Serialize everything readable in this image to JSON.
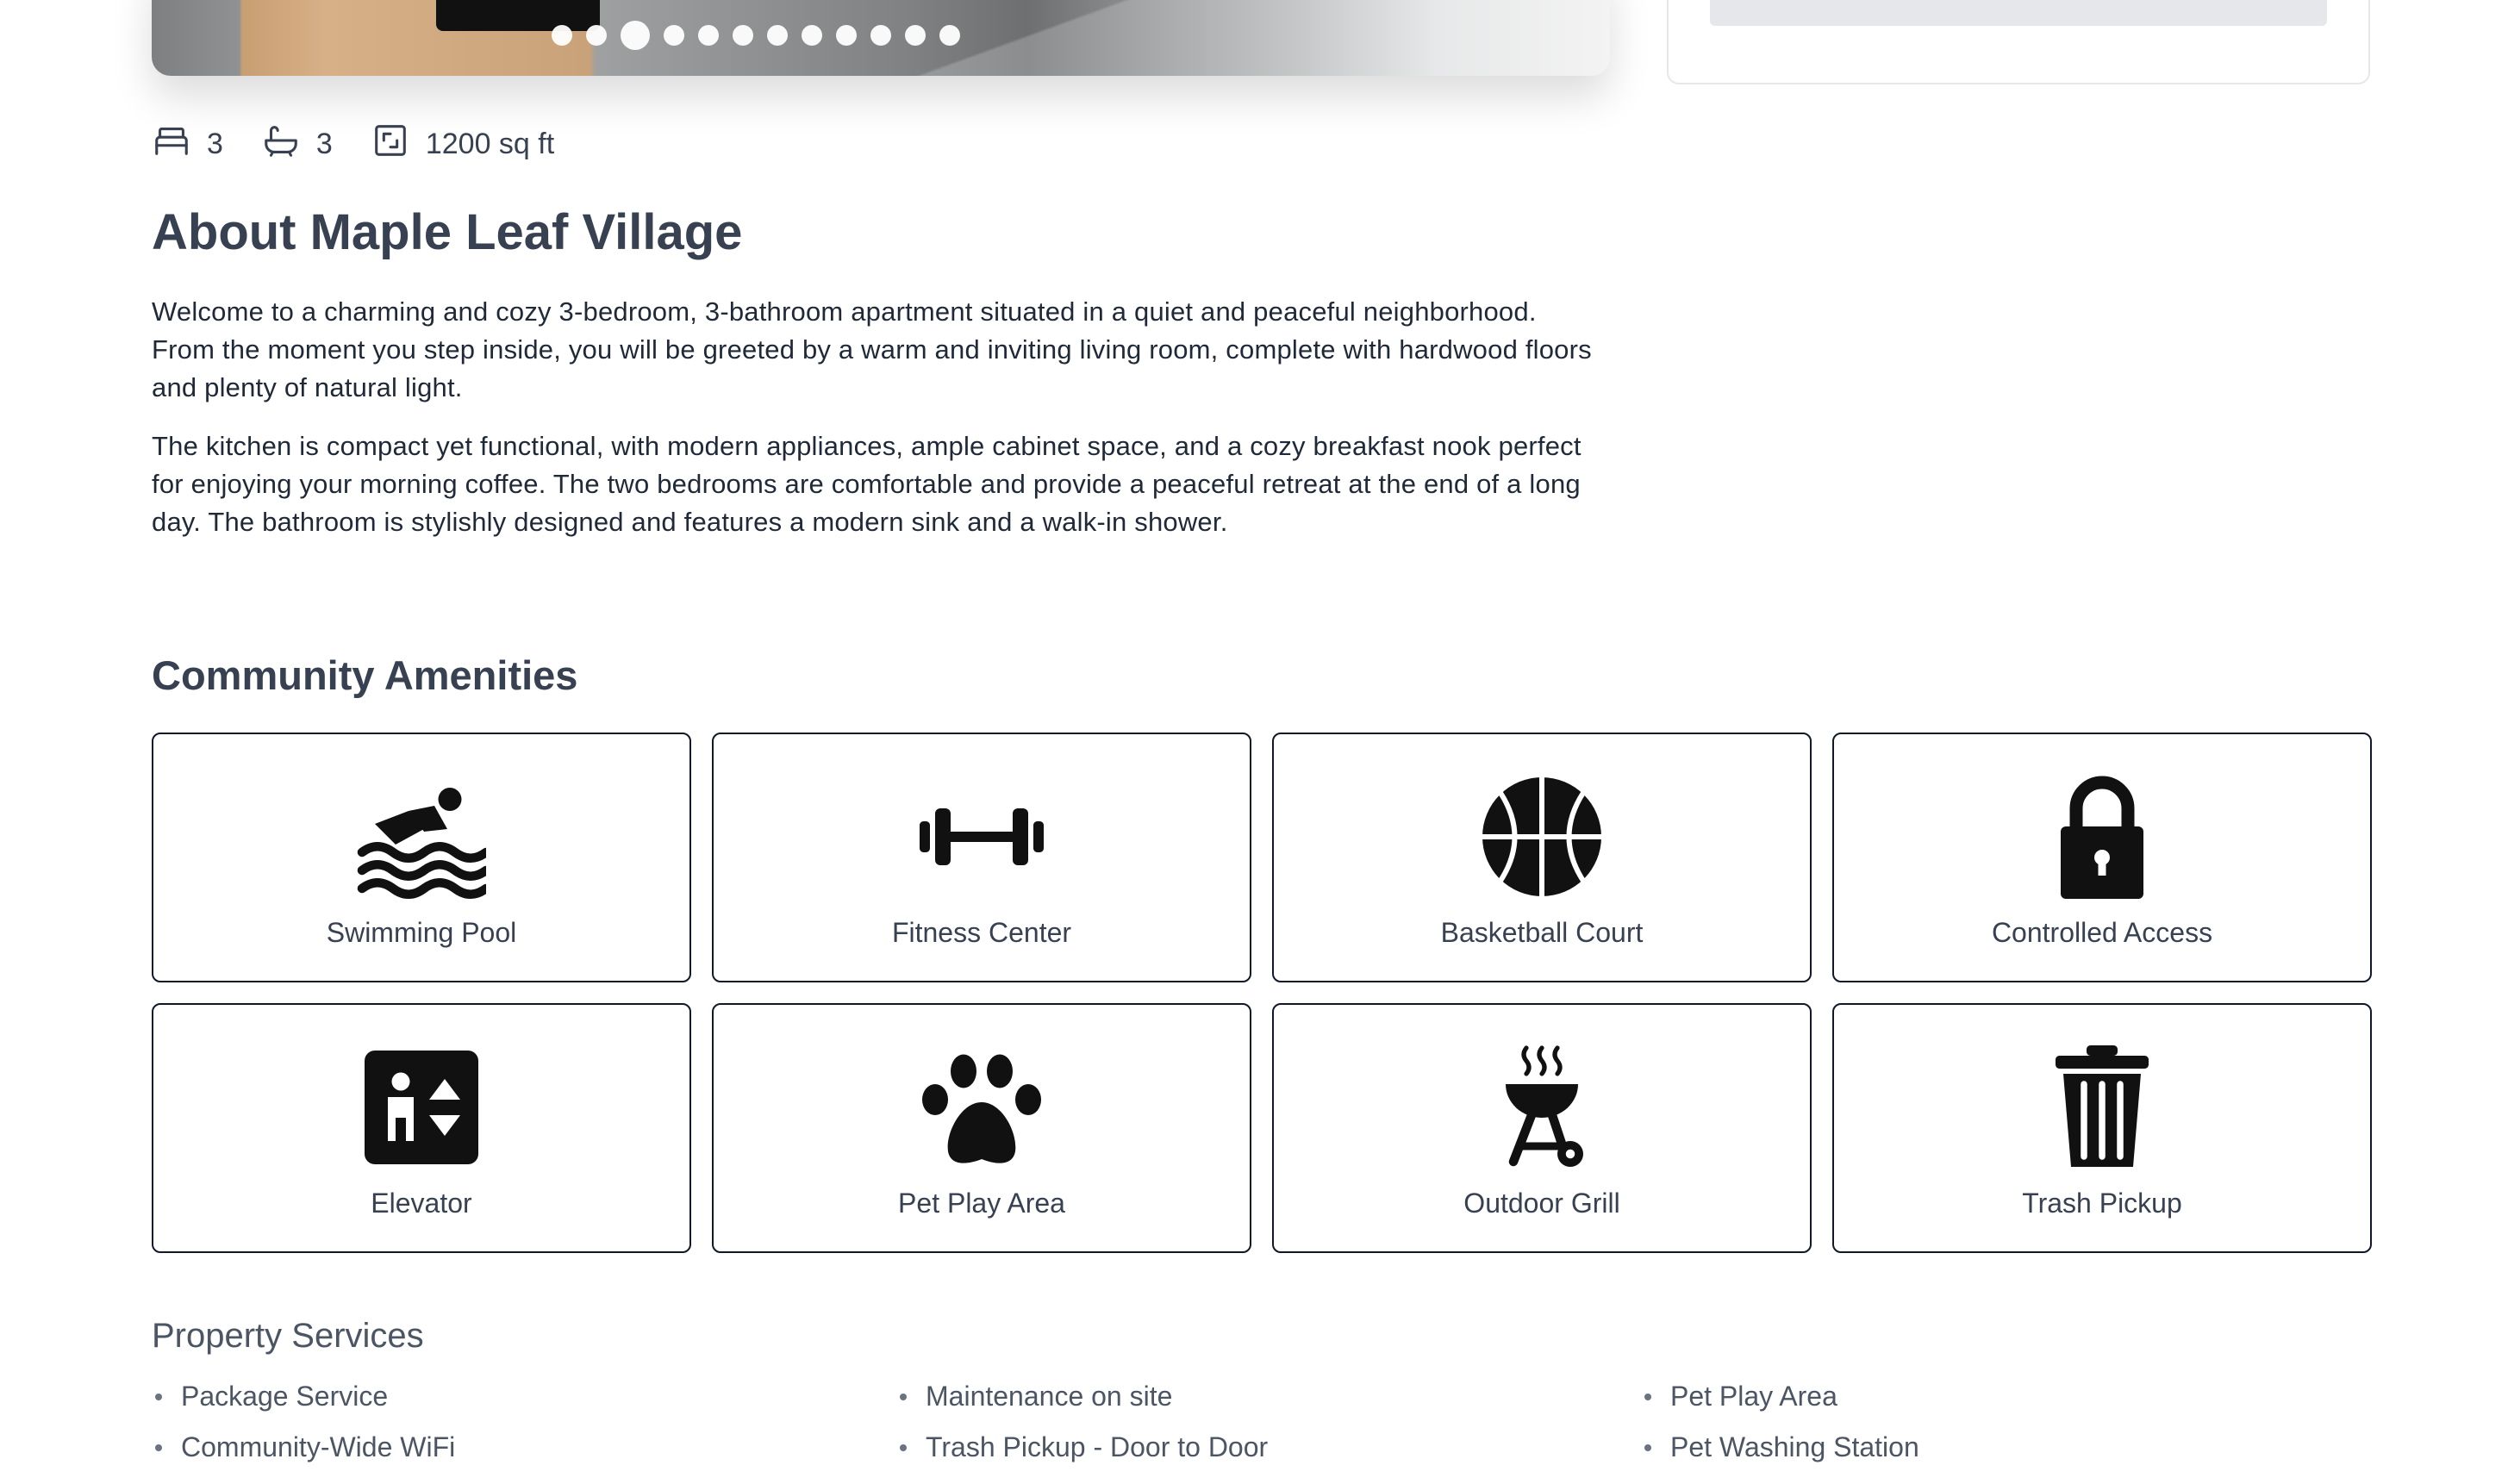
{
  "gallery": {
    "dot_count": 12,
    "active_dot": 3
  },
  "stats": {
    "beds": "3",
    "baths": "3",
    "area": "1200 sq ft"
  },
  "about": {
    "title": "About Maple Leaf Village",
    "paragraphs": [
      "Welcome to a charming and cozy 3-bedroom, 3-bathroom apartment situated in a quiet and peaceful neighborhood. From the moment you step inside, you will be greeted by a warm and inviting living room, complete with hardwood floors and plenty of natural light.",
      "The kitchen is compact yet functional, with modern appliances, ample cabinet space, and a cozy breakfast nook perfect for enjoying your morning coffee. The two bedrooms are comfortable and provide a peaceful retreat at the end of a long day. The bathroom is stylishly designed and features a modern sink and a walk-in shower."
    ]
  },
  "amenities": {
    "title": "Community Amenities",
    "items": [
      {
        "label": "Swimming Pool",
        "icon": "swimmer-icon"
      },
      {
        "label": "Fitness Center",
        "icon": "dumbbell-icon"
      },
      {
        "label": "Basketball Court",
        "icon": "basketball-icon"
      },
      {
        "label": "Controlled Access",
        "icon": "lock-icon"
      },
      {
        "label": "Elevator",
        "icon": "elevator-icon"
      },
      {
        "label": "Pet Play Area",
        "icon": "paw-icon"
      },
      {
        "label": "Outdoor Grill",
        "icon": "grill-icon"
      },
      {
        "label": "Trash Pickup",
        "icon": "trash-icon"
      }
    ]
  },
  "services": {
    "title": "Property Services",
    "items": [
      "Package Service",
      "Maintenance on site",
      "Pet Play Area",
      "Community-Wide WiFi",
      "Trash Pickup - Door to Door",
      "Pet Washing Station"
    ]
  }
}
